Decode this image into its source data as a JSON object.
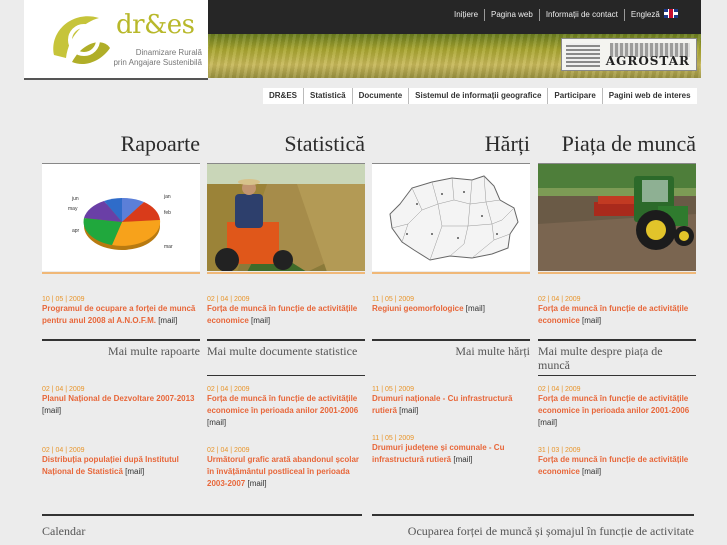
{
  "logo": {
    "title": "dr&es",
    "subtitle_line1": "Dinamizare Rurală",
    "subtitle_line2": "prin Angajare Sustenibilă"
  },
  "top_nav": [
    "Inițiere",
    "Pagina web",
    "Informații de contact",
    "Engleză"
  ],
  "partner": {
    "name": "AGROSTAR"
  },
  "sec_nav": [
    "DR&ES",
    "Statistică",
    "Documente",
    "Sistemul de informații geografice",
    "Participare",
    "Pagini web de interes"
  ],
  "columns": [
    {
      "title": "Rapoarte",
      "image": "pie-chart",
      "pie_labels": [
        "jun",
        "jan",
        "may",
        "feb",
        "apr",
        "mar"
      ],
      "pie_colors": [
        "#5b7fd8",
        "#d93b1a",
        "#f7a21b",
        "#20a83d",
        "#6a3fa6",
        "#2f6cc9"
      ],
      "news1": [
        {
          "date": "10 | 05 | 2009",
          "text": "Programul de ocupare a forței de muncă pentru anul 2008 al A.N.O.F.M.",
          "mail": "[mail]"
        }
      ],
      "more": "Mai multe rapoarte",
      "news2": [
        {
          "date": "02 | 04 | 2009",
          "text": "Planul Național de Dezvoltare 2007-2013",
          "mail": "[mail]"
        },
        {
          "date": "02 | 04 | 2009",
          "text": "Distribuția populației după Institutul Național de Statistică",
          "mail": "[mail]"
        }
      ]
    },
    {
      "title": "Statistică",
      "image": "tractor-corn-field",
      "news1": [
        {
          "date": "02 | 04 | 2009",
          "text": "Forța de muncă în funcție de activitățile economice",
          "mail": "[mail]"
        }
      ],
      "more": "Mai multe documente statistice",
      "news2": [
        {
          "date": "02 | 04 | 2009",
          "text": "Forța de muncă în funcție de activitățile economice în perioada anilor 2001-2006",
          "mail": "[mail]"
        },
        {
          "date": "02 | 04 | 2009",
          "text": "Următorul grafic arată abandonul școlar în învățământul postliceal în perioada 2003-2007",
          "mail": "[mail]"
        }
      ]
    },
    {
      "title": "Hărți",
      "image": "romania-map",
      "news1": [
        {
          "date": "11 | 05 | 2009",
          "text": "Regiuni geomorfologice",
          "mail": "[mail]"
        }
      ],
      "more": "Mai multe hărți",
      "news2": [
        {
          "date": "11 | 05 | 2009",
          "text": "Drumuri naționale - Cu infrastructură rutieră",
          "mail": "[mail]"
        },
        {
          "date": "11 | 05 | 2009",
          "text": "Drumuri județene și comunale - Cu infrastructură rutieră",
          "mail": "[mail]"
        }
      ]
    },
    {
      "title": "Piața de muncă",
      "image": "green-tractor-field",
      "news1": [
        {
          "date": "02 | 04 | 2009",
          "text": "Forța de muncă în funcție de activitățile economice",
          "mail": "[mail]"
        }
      ],
      "more": "Mai multe despre piața de muncă",
      "news2": [
        {
          "date": "02 | 04 | 2009",
          "text": "Forța de muncă în funcție de activitățile economice în perioada anilor 2001-2006",
          "mail": "[mail]"
        },
        {
          "date": "31 | 03 | 2009",
          "text": "Forța de muncă în funcție de activitățile economice",
          "mail": "[mail]"
        }
      ]
    }
  ],
  "bottom": {
    "calendar": "Calendar",
    "chart_title": "Ocuparea forței de muncă și șomajul în funcție de activitate"
  }
}
